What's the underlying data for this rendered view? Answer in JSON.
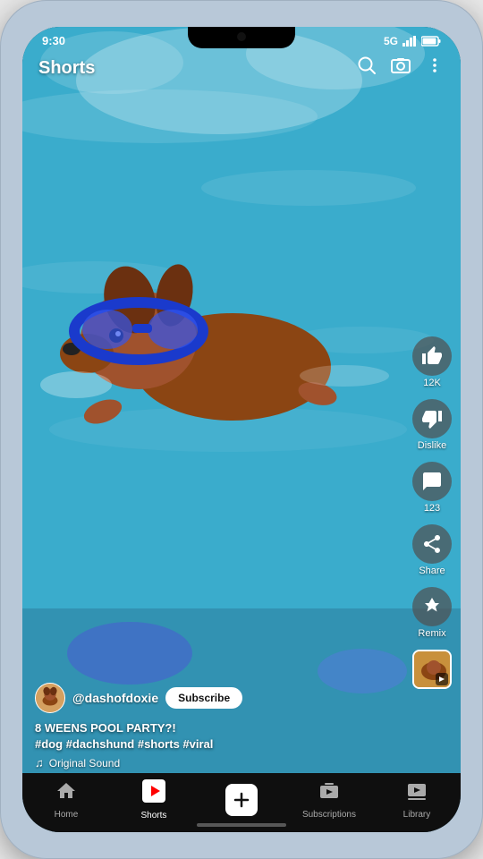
{
  "statusBar": {
    "time": "9:30",
    "signal": "5G",
    "batteryIcon": "🔋"
  },
  "appBar": {
    "title": "Shorts",
    "searchLabel": "search",
    "cameraLabel": "camera",
    "moreLabel": "more"
  },
  "actions": {
    "like": {
      "icon": "👍",
      "count": "12K",
      "label": "12K"
    },
    "dislike": {
      "icon": "👎",
      "label": "Dislike"
    },
    "comment": {
      "icon": "💬",
      "count": "123",
      "label": "123"
    },
    "share": {
      "icon": "↗",
      "label": "Share"
    },
    "remix": {
      "icon": "⚡",
      "label": "Remix"
    }
  },
  "video": {
    "channel": "@dashofdoxie",
    "subscribeLabel": "Subscribe",
    "title": "8 WEENS POOL PARTY?!",
    "hashtags": "#dog #dachshund #shorts #viral",
    "sound": "Original Sound"
  },
  "bottomNav": {
    "items": [
      {
        "id": "home",
        "label": "Home",
        "active": false
      },
      {
        "id": "shorts",
        "label": "Shorts",
        "active": true
      },
      {
        "id": "create",
        "label": "",
        "active": false
      },
      {
        "id": "subscriptions",
        "label": "Subscriptions",
        "active": false
      },
      {
        "id": "library",
        "label": "Library",
        "active": false
      }
    ]
  }
}
